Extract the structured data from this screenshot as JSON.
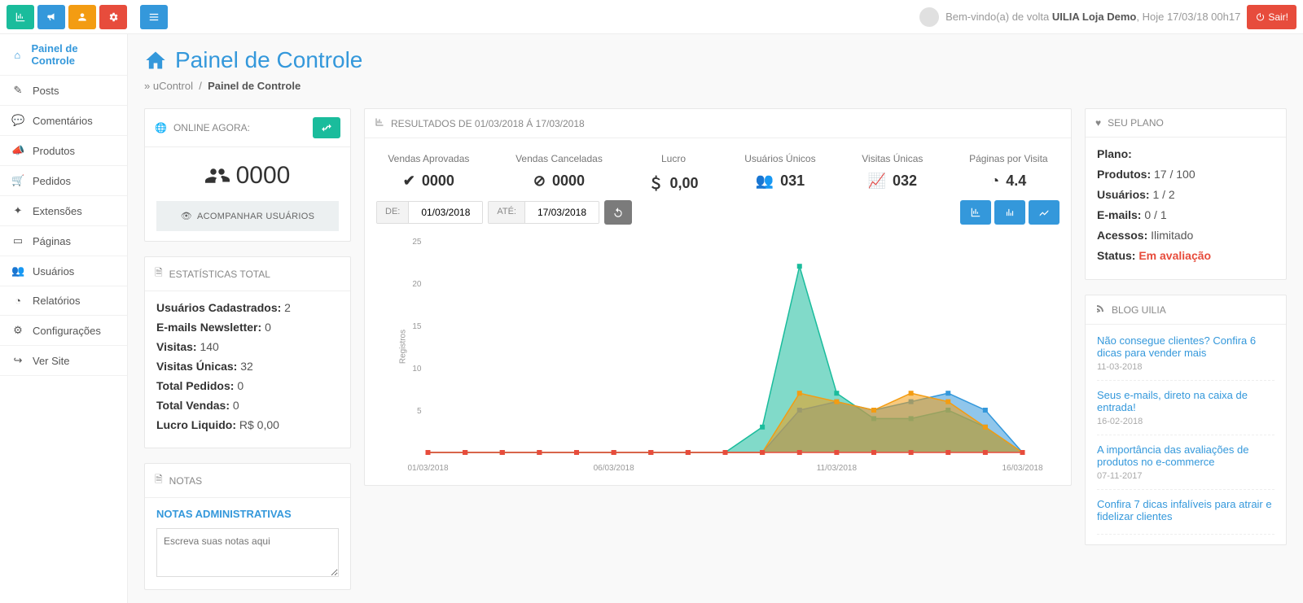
{
  "topbar": {
    "welcome_prefix": "Bem-vindo(a) de volta ",
    "welcome_name": "UILIA Loja Demo",
    "welcome_datetime": ", Hoje 17/03/18 00h17",
    "logout_label": "Sair!"
  },
  "sidebar": {
    "items": [
      {
        "label": "Painel de Controle",
        "active": true
      },
      {
        "label": "Posts"
      },
      {
        "label": "Comentários"
      },
      {
        "label": "Produtos"
      },
      {
        "label": "Pedidos"
      },
      {
        "label": "Extensões"
      },
      {
        "label": "Páginas"
      },
      {
        "label": "Usuários"
      },
      {
        "label": "Relatórios"
      },
      {
        "label": "Configurações"
      },
      {
        "label": "Ver Site"
      }
    ]
  },
  "page": {
    "title": "Painel de Controle",
    "crumb_root": "» uControl",
    "crumb_sep": "/",
    "crumb_current": "Painel de Controle"
  },
  "online_box": {
    "title": "ONLINE AGORA:",
    "count": "0000",
    "follow_label": "ACOMPANHAR USUÁRIOS"
  },
  "stats_box": {
    "title": "ESTATÍSTICAS TOTAL",
    "rows": {
      "users_label": "Usuários Cadastrados:",
      "users_val": "2",
      "news_label": "E-mails Newsletter:",
      "news_val": "0",
      "visits_label": "Visitas:",
      "visits_val": "140",
      "uvisits_label": "Visitas Únicas:",
      "uvisits_val": "32",
      "orders_label": "Total Pedidos:",
      "orders_val": "0",
      "sales_label": "Total Vendas:",
      "sales_val": "0",
      "profit_label": "Lucro Liquido:",
      "profit_val": "R$ 0,00"
    }
  },
  "notes_box": {
    "title": "NOTAS",
    "subtitle": "NOTAS ADMINISTRATIVAS",
    "placeholder": "Escreva suas notas aqui"
  },
  "results_box": {
    "title": "RESULTADOS DE 01/03/2018 Á 17/03/2018",
    "cards": [
      {
        "label": "Vendas Aprovadas",
        "value": "0000"
      },
      {
        "label": "Vendas Canceladas",
        "value": "0000"
      },
      {
        "label": "Lucro",
        "value": "0,00"
      },
      {
        "label": "Usuários Únicos",
        "value": "031"
      },
      {
        "label": "Visitas Únicas",
        "value": "032"
      },
      {
        "label": "Páginas por Visita",
        "value": "4.4"
      }
    ],
    "filter": {
      "from_label": "DE:",
      "from_val": "01/03/2018",
      "to_label": "ATÉ:",
      "to_val": "17/03/2018"
    }
  },
  "plan_box": {
    "title": "SEU PLANO",
    "rows": {
      "plan_label": "Plano:",
      "prod_label": "Produtos:",
      "prod_val": "17 / 100",
      "users_label": "Usuários:",
      "users_val": "1 / 2",
      "emails_label": "E-mails:",
      "emails_val": "0 / 1",
      "access_label": "Acessos:",
      "access_val": "Ilimitado",
      "status_label": "Status:",
      "status_val": "Em avaliação"
    }
  },
  "blog_box": {
    "title": "BLOG UILIA",
    "items": [
      {
        "title": "Não consegue clientes? Confira 6 dicas para vender mais",
        "date": "11-03-2018"
      },
      {
        "title": "Seus e-mails, direto na caixa de entrada!",
        "date": "16-02-2018"
      },
      {
        "title": "A importância das avaliações de produtos no e-commerce",
        "date": "07-11-2017"
      },
      {
        "title": "Confira 7 dicas infalíveis para atrair e fidelizar clientes",
        "date": ""
      }
    ]
  },
  "chart_data": {
    "type": "area",
    "xlabel_dates": [
      "01/03/2018",
      "06/03/2018",
      "11/03/2018",
      "16/03/2018"
    ],
    "ylabel": "Registros",
    "y_ticks": [
      5,
      10,
      15,
      20,
      25
    ],
    "ylim": [
      0,
      25
    ],
    "x": [
      "01/03",
      "02/03",
      "03/03",
      "04/03",
      "05/03",
      "06/03",
      "07/03",
      "08/03",
      "09/03",
      "10/03",
      "11/03",
      "12/03",
      "13/03",
      "14/03",
      "15/03",
      "16/03",
      "17/03"
    ],
    "series": [
      {
        "name": "green",
        "color": "#1abc9c",
        "values": [
          0,
          0,
          0,
          0,
          0,
          0,
          0,
          0,
          0,
          3,
          22,
          7,
          4,
          4,
          5,
          3,
          0
        ]
      },
      {
        "name": "blue",
        "color": "#3498db",
        "values": [
          0,
          0,
          0,
          0,
          0,
          0,
          0,
          0,
          0,
          0,
          5,
          6,
          5,
          6,
          7,
          5,
          0
        ]
      },
      {
        "name": "orange",
        "color": "#f39c12",
        "values": [
          0,
          0,
          0,
          0,
          0,
          0,
          0,
          0,
          0,
          0,
          7,
          6,
          5,
          7,
          6,
          3,
          0
        ]
      },
      {
        "name": "red",
        "color": "#e74c3c",
        "values": [
          0,
          0,
          0,
          0,
          0,
          0,
          0,
          0,
          0,
          0,
          0,
          0,
          0,
          0,
          0,
          0,
          0
        ]
      }
    ]
  }
}
